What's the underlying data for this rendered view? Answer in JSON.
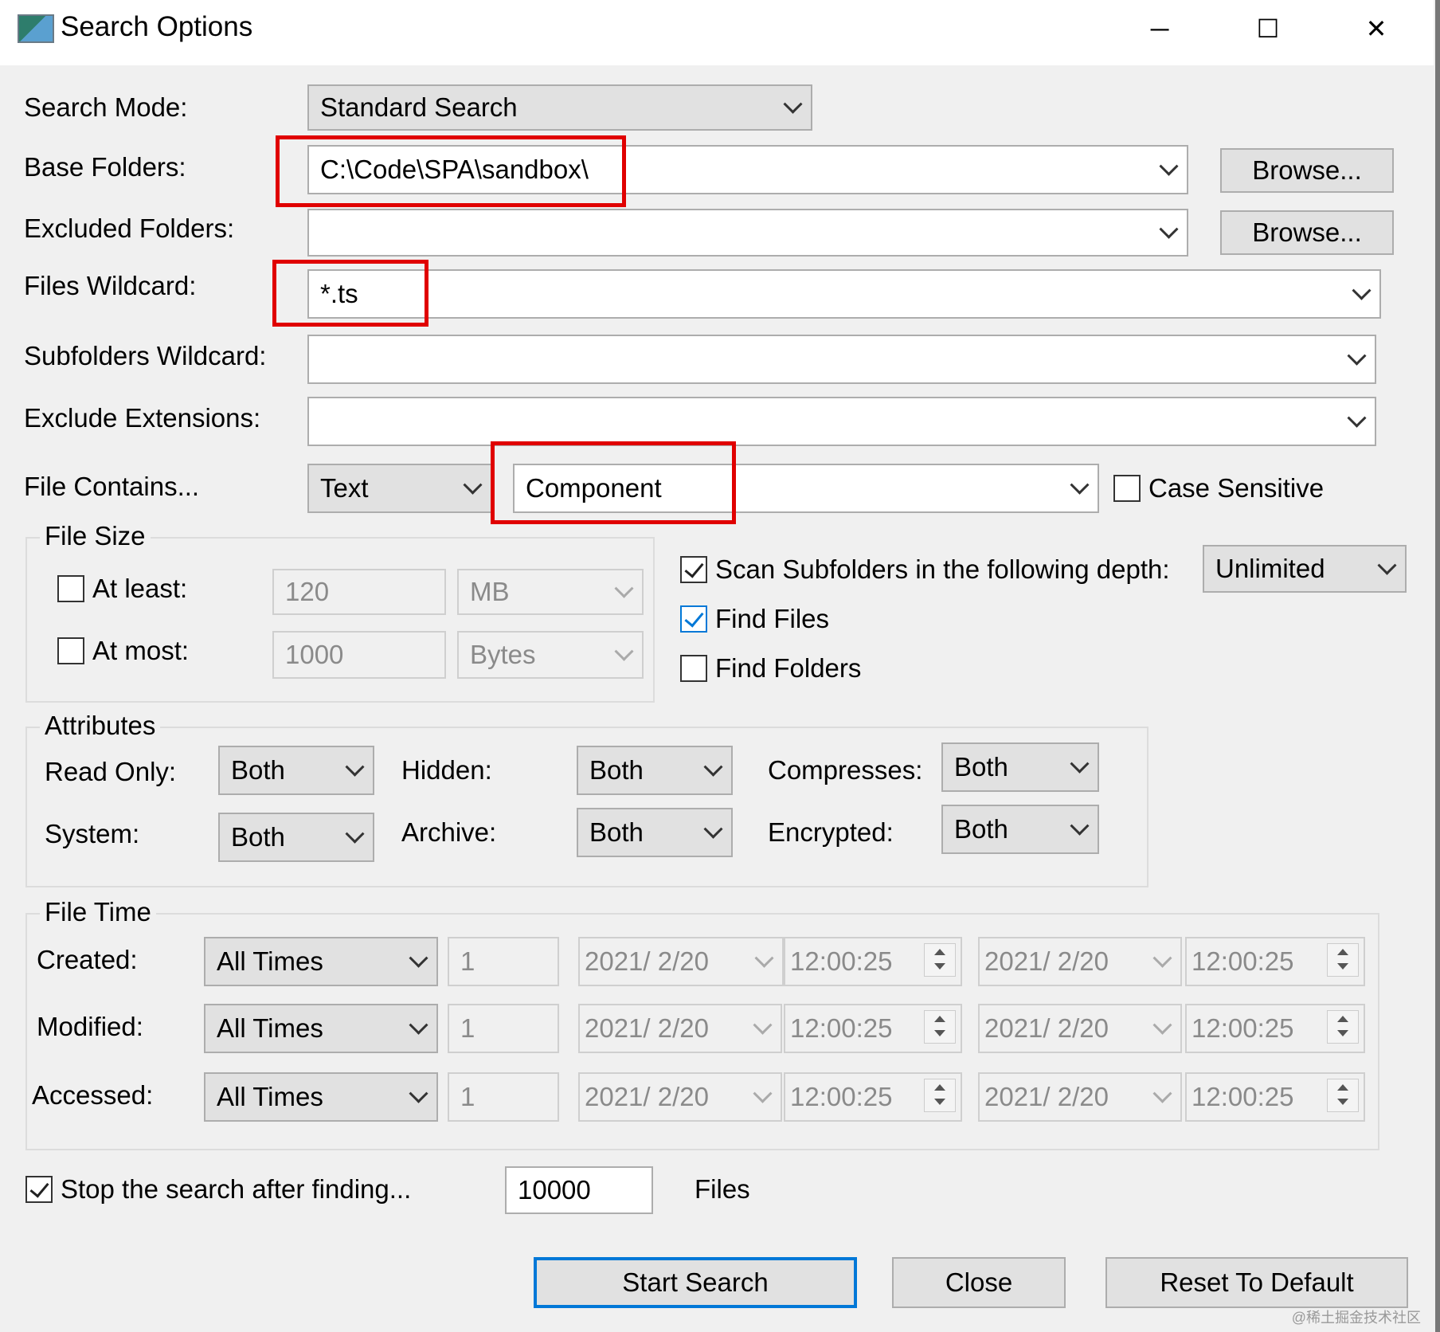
{
  "window": {
    "title": "Search Options",
    "minimize_glyph": "─",
    "maximize_glyph": "☐",
    "close_glyph": "✕"
  },
  "labels": {
    "search_mode": "Search Mode:",
    "base_folders": "Base Folders:",
    "excluded_folders": "Excluded Folders:",
    "files_wildcard": "Files Wildcard:",
    "subfolders_wildcard": "Subfolders Wildcard:",
    "exclude_extensions": "Exclude Extensions:",
    "file_contains": "File Contains...",
    "case_sensitive": "Case Sensitive"
  },
  "fields": {
    "search_mode": "Standard Search",
    "base_folders": "C:\\Code\\SPA\\sandbox\\",
    "excluded_folders": "",
    "files_wildcard": "*.ts",
    "subfolders_wildcard": "",
    "exclude_extensions": "",
    "contains_type": "Text",
    "contains_value": "Component",
    "browse": "Browse..."
  },
  "file_size": {
    "title": "File Size",
    "at_least_label": "At least:",
    "at_least_value": "120",
    "at_least_unit": "MB",
    "at_most_label": "At most:",
    "at_most_value": "1000",
    "at_most_unit": "Bytes"
  },
  "scan": {
    "scan_label": "Scan Subfolders in the following depth:",
    "depth": "Unlimited",
    "find_files": "Find Files",
    "find_folders": "Find Folders"
  },
  "attributes": {
    "title": "Attributes",
    "read_only_label": "Read Only:",
    "read_only": "Both",
    "hidden_label": "Hidden:",
    "hidden": "Both",
    "compresses_label": "Compresses:",
    "compresses": "Both",
    "system_label": "System:",
    "system": "Both",
    "archive_label": "Archive:",
    "archive": "Both",
    "encrypted_label": "Encrypted:",
    "encrypted": "Both"
  },
  "file_time": {
    "title": "File Time",
    "rows": [
      {
        "label": "Created:",
        "mode": "All Times",
        "count": "1",
        "date1": "2021/  2/20",
        "time1": "12:00:25",
        "date2": "2021/  2/20",
        "time2": "12:00:25"
      },
      {
        "label": "Modified:",
        "mode": "All Times",
        "count": "1",
        "date1": "2021/  2/20",
        "time1": "12:00:25",
        "date2": "2021/  2/20",
        "time2": "12:00:25"
      },
      {
        "label": "Accessed:",
        "mode": "All Times",
        "count": "1",
        "date1": "2021/  2/20",
        "time1": "12:00:25",
        "date2": "2021/  2/20",
        "time2": "12:00:25"
      }
    ]
  },
  "stop": {
    "label": "Stop the search after finding...",
    "value": "10000",
    "unit": "Files"
  },
  "buttons": {
    "start": "Start Search",
    "close": "Close",
    "reset": "Reset To Default"
  },
  "watermark": "@稀土掘金技术社区"
}
